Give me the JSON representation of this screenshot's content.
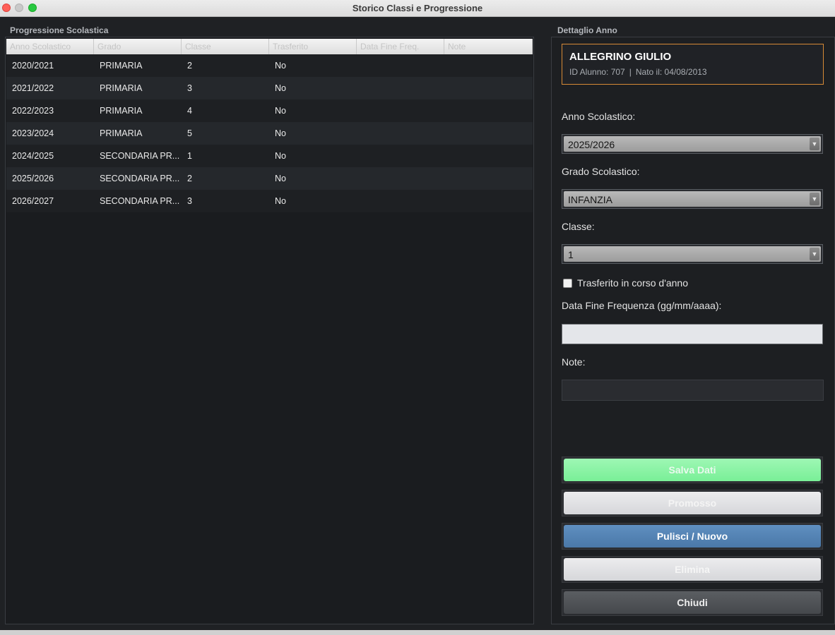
{
  "window": {
    "title": "Storico Classi e Progressione"
  },
  "left": {
    "legend": "Progressione Scolastica",
    "columns": [
      "Anno Scolastico",
      "Grado",
      "Classe",
      "Trasferito",
      "Data Fine Freq.",
      "Note"
    ],
    "rows": [
      [
        "2020/2021",
        "PRIMARIA",
        "2",
        "No",
        "",
        ""
      ],
      [
        "2021/2022",
        "PRIMARIA",
        "3",
        "No",
        "",
        ""
      ],
      [
        "2022/2023",
        "PRIMARIA",
        "4",
        "No",
        "",
        ""
      ],
      [
        "2023/2024",
        "PRIMARIA",
        "5",
        "No",
        "",
        ""
      ],
      [
        "2024/2025",
        "SECONDARIA PR...",
        "1",
        "No",
        "",
        ""
      ],
      [
        "2025/2026",
        "SECONDARIA PR...",
        "2",
        "No",
        "",
        ""
      ],
      [
        "2026/2027",
        "SECONDARIA PR...",
        "3",
        "No",
        "",
        ""
      ]
    ]
  },
  "right": {
    "legend": "Dettaglio Anno",
    "student": {
      "name": "ALLEGRINO GIULIO",
      "id_text": "ID Alunno: 707",
      "separator": "|",
      "birth_text": "Nato il: 04/08/2013"
    },
    "anno_label": "Anno Scolastico:",
    "anno_value": "2025/2026",
    "grado_label": "Grado Scolastico:",
    "grado_value": "INFANZIA",
    "classe_label": "Classe:",
    "classe_value": "1",
    "trasferito_label": "Trasferito in corso d'anno",
    "data_fine_label": "Data Fine Frequenza (gg/mm/aaaa):",
    "data_fine_value": "",
    "note_label": "Note:",
    "note_value": "",
    "buttons": {
      "save": "Salva Dati",
      "promote": "Promosso",
      "new": "Pulisci / Nuovo",
      "delete": "Elimina",
      "close": "Chiudi"
    }
  },
  "colors": {
    "accent_border": "#d78a36",
    "save_button": "#79ef97",
    "new_button": "#4a78a8"
  },
  "icons": {
    "combo_arrow": "chevron-down-icon"
  }
}
